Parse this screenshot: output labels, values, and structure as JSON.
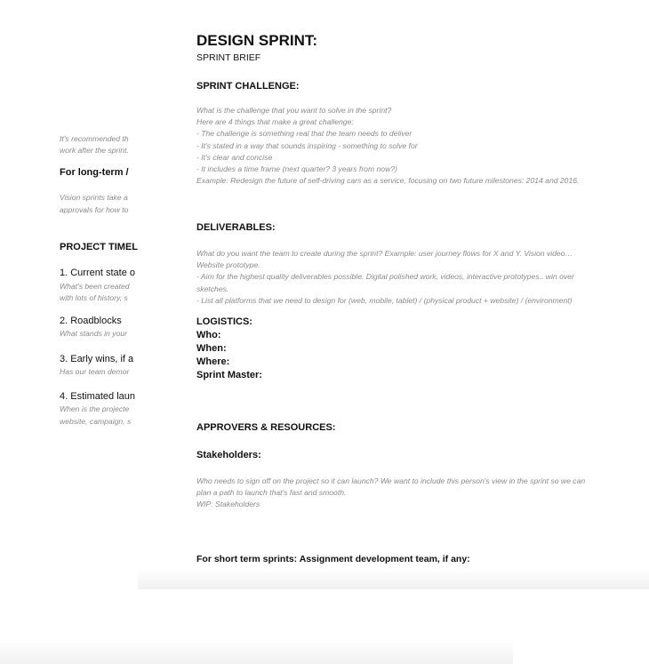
{
  "back_page": {
    "intro": [
      "It's recommended th",
      "work after the sprint."
    ],
    "long_term_heading": "For long-term  / ",
    "vision": [
      "Vision sprints take a",
      "approvals for how to"
    ],
    "timeline_heading": "PROJECT TIMEL",
    "items": [
      {
        "title": "1. Current state o",
        "desc": [
          "What's been created",
          "with lots of history, s"
        ]
      },
      {
        "title": "2. Roadblocks",
        "desc": [
          "What stands in your"
        ]
      },
      {
        "title": "3. Early wins, if a",
        "desc": [
          "Has our team demor"
        ]
      },
      {
        "title": "4. Estimated laun",
        "desc": [
          "When is the projecte",
          "website, campaign, s"
        ]
      }
    ]
  },
  "front_page": {
    "title": "DESIGN SPRINT:",
    "subtitle": "SPRINT BRIEF",
    "challenge_heading": "SPRINT CHALLENGE:",
    "challenge_text": [
      "What is the challenge that you want to solve in the sprint?",
      "Here are 4 things that make a great challenge:",
      "- The challenge is something real that the team needs to deliver",
      "- It's stated in a way that sounds inspiring - something to solve for",
      "- It's clear and concise",
      "- It includes a time frame (next quarter? 3 years from now?)",
      "Example: Redesign the future of self-driving cars as a service, focusing on two future milestones: 2014 and 2016."
    ],
    "deliverables_heading": "DELIVERABLES:",
    "deliverables_text": [
      "What do you want the team to create during the sprint? Example: user journey flows for X and Y. Vision video… Website prototype.",
      "- Aim for the highest quality deliverables possible. Digital polished work, videos, interactive prototypes.. win over sketches.",
      "- List all platforms that we need to design for (web, mobile, tablet) / (physical product + website) / (environment)"
    ],
    "logistics_heading": "LOGISTICS:",
    "logistics": [
      "Who:",
      "When:",
      "Where:",
      "Sprint Master:"
    ],
    "approvers_heading": "APPROVERS & RESOURCES:",
    "stakeholders_heading": "Stakeholders:",
    "stakeholders_text": [
      "Who needs to sign off on the project so it can launch? We want to include this person's view in the sprint so we can plan a path to launch that's fast and smooth.",
      "WIP: Stakeholders"
    ],
    "short_term_heading": "For short term sprints: Assignment development team, if any:"
  }
}
